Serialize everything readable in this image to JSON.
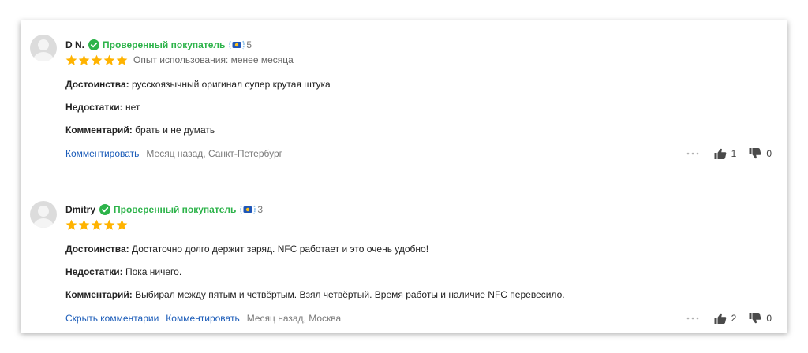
{
  "labels": {
    "pros": "Достоинства:",
    "cons": "Недостатки:",
    "comment": "Комментарий:"
  },
  "reviews": [
    {
      "author": "D N.",
      "verified_label": "Проверенный покупатель",
      "badge_count": "5",
      "rating": 5,
      "usage": "Опыт использования: менее месяца",
      "pros": "русскоязычный оригинал супер крутая штука",
      "cons": "нет",
      "comment": "брать и не думать",
      "hide_comments_label": "",
      "comment_link_label": "Комментировать",
      "meta": "Месяц назад, Санкт-Петербург",
      "likes": "1",
      "dislikes": "0"
    },
    {
      "author": "Dmitry",
      "verified_label": "Проверенный покупатель",
      "badge_count": "3",
      "rating": 5,
      "usage": "",
      "pros": "Достаточно долго держит заряд. NFC работает и это очень удобно!",
      "cons": "Пока ничего.",
      "comment": "Выбирал между пятым и четвёртым. Взял четвёртый. Время работы и наличие NFC перевесило.",
      "hide_comments_label": "Скрыть комментарии",
      "comment_link_label": "Комментировать",
      "meta": "Месяц назад, Москва",
      "likes": "2",
      "dislikes": "0"
    }
  ],
  "colors": {
    "verified": "#2db34a",
    "star": "#ffb300",
    "link": "#1a5bb8",
    "vote_icon": "#4a4a4a"
  },
  "icons": {
    "verified": "check-circle-icon",
    "badge": "laurel-badge-icon",
    "star": "star-icon",
    "more": "ellipsis-icon",
    "like": "thumbs-up-icon",
    "dislike": "thumbs-down-icon"
  }
}
